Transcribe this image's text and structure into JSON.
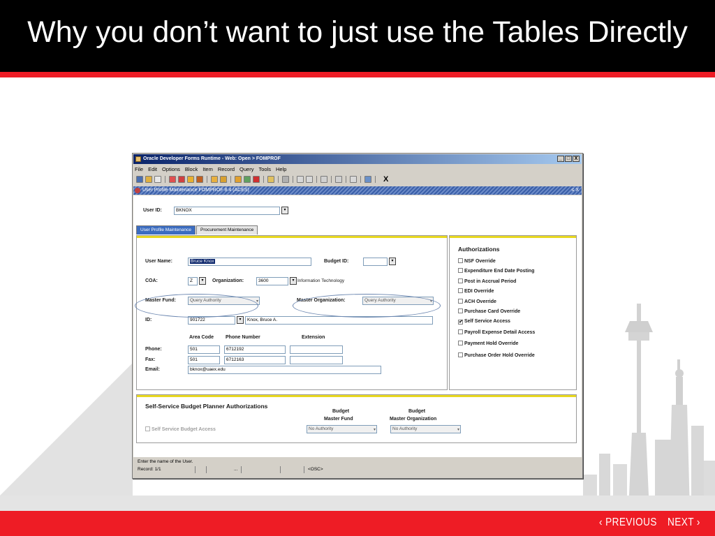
{
  "slide": {
    "title": "Why you don’t want to just use the Tables Directly",
    "nav_prev": "‹ PREVIOUS",
    "nav_next": "NEXT ›"
  },
  "colors": {
    "accent_red": "#ee1c25",
    "header_black": "#000000",
    "skyline_gray": "#dedede"
  },
  "window": {
    "title": "Oracle Developer Forms Runtime - Web: Open > FOMPROF",
    "buttons": [
      "_",
      "□",
      "X"
    ],
    "menu": [
      "File",
      "Edit",
      "Options",
      "Block",
      "Item",
      "Record",
      "Query",
      "Tools",
      "Help"
    ],
    "toolbar_close": "X",
    "form_title": "User Profile Maintenance  FOMPROF  8.4  (ACES)",
    "form_buttons": "≤ X"
  },
  "form": {
    "user_id_label": "User ID:",
    "user_id_value": "BKNOX",
    "tabs": [
      "User Profile Maintenance",
      "Procurement Maintenance"
    ],
    "user_name_label": "User Name:",
    "user_name_value": "Bruce Knox",
    "budget_id_label": "Budget ID:",
    "budget_id_value": "",
    "coa_label": "COA:",
    "coa_value": "Z",
    "organization_label": "Organization:",
    "organization_value": "3600",
    "organization_desc": "Information Technology",
    "master_fund_label": "Master Fund:",
    "master_fund_value": "Query Authority",
    "master_org_label": "Master Organization:",
    "master_org_value": "Query Authority",
    "id_label": "ID:",
    "id_value": "901722",
    "id_name": "Knox, Bruce A.",
    "area_code_header": "Area Code",
    "phone_number_header": "Phone Number",
    "extension_header": "Extension",
    "phone_label": "Phone:",
    "phone_area": "501",
    "phone_number": "6712192",
    "phone_ext": "",
    "fax_label": "Fax:",
    "fax_area": "501",
    "fax_number": "6712163",
    "fax_ext": "",
    "email_label": "Email:",
    "email_value": "bknox@uaex.edu"
  },
  "authorizations": {
    "title": "Authorizations",
    "items": [
      {
        "label": "NSF Override",
        "checked": false,
        "mark": ""
      },
      {
        "label": "Expenditure End Date Posting",
        "checked": false,
        "mark": ""
      },
      {
        "label": "Post in Accrual Period",
        "checked": false,
        "mark": ""
      },
      {
        "label": "EDI Override",
        "checked": false,
        "mark": ""
      },
      {
        "label": "ACH Override",
        "checked": false,
        "mark": ""
      },
      {
        "label": "Purchase Card Override",
        "checked": false,
        "mark": ""
      },
      {
        "label": "Self Service Access",
        "checked": true,
        "mark": "✔"
      },
      {
        "label": "Payroll Expense Detail Access",
        "checked": false,
        "mark": ""
      },
      {
        "label": "Payment Hold Override",
        "checked": false,
        "mark": ""
      },
      {
        "label": "Purchase Order Hold Override",
        "checked": false,
        "mark": ""
      }
    ]
  },
  "budget_planner": {
    "title": "Self-Service Budget Planner Authorizations",
    "col1_header_line1": "Budget",
    "col1_header_line2": "Master Fund",
    "col2_header_line1": "Budget",
    "col2_header_line2": "Master Organization",
    "access_label": "Self Service Budget Access",
    "fund_value": "No Authority",
    "org_value": "No Authority"
  },
  "status": {
    "message": "Enter the name of the User.",
    "record": "Record: 1/1",
    "ellipsis": "...",
    "osc": "<OSC>"
  }
}
